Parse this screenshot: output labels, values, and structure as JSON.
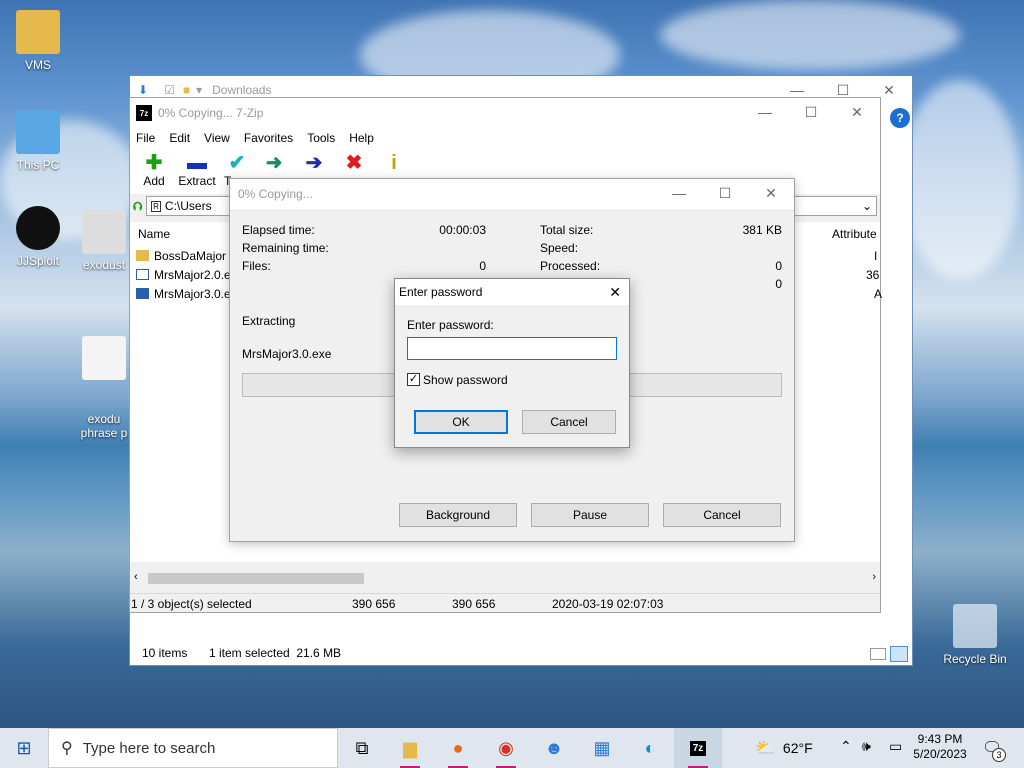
{
  "desktop": {
    "icons": [
      {
        "label": "VMS"
      },
      {
        "label": "This PC"
      },
      {
        "label": "JJSploit"
      },
      {
        "label": "exodust"
      },
      {
        "label": "exodu\nphrase p"
      },
      {
        "label": "Recycle Bin"
      }
    ]
  },
  "explorer": {
    "title": "Downloads",
    "status_items": "10 items",
    "status_selected": "1 item selected  21.6 MB"
  },
  "zip": {
    "title": "0% Copying... 7-Zip",
    "menu": [
      "File",
      "Edit",
      "View",
      "Favorites",
      "Tools",
      "Help"
    ],
    "toolbar": [
      "Add",
      "Extract",
      "T"
    ],
    "address": "C:\\Users",
    "columns": {
      "name": "Name",
      "attributes": "Attribute"
    },
    "files": [
      "BossDaMajor",
      "MrsMajor2.0.ex",
      "MrsMajor3.0.ex"
    ],
    "right_col_partial": [
      "I",
      "36",
      "A"
    ],
    "status": {
      "selected": "1 / 3 object(s) selected",
      "size": "390 656",
      "packed": "390 656",
      "modified": "2020-03-19 02:07:03"
    }
  },
  "progress": {
    "title": "0% Copying...",
    "elapsed_label": "Elapsed time:",
    "elapsed_value": "00:00:03",
    "remaining_label": "Remaining time:",
    "files_label": "Files:",
    "files_value": "0",
    "total_label": "Total size:",
    "total_value": "381 KB",
    "speed_label": "Speed:",
    "processed_label": "Processed:",
    "processed_value": "0",
    "fourth_value": "0",
    "operation": "Extracting",
    "current_file": "MrsMajor3.0.exe",
    "progress_fraction": 0.0,
    "buttons": {
      "background": "Background",
      "pause": "Pause",
      "cancel": "Cancel"
    }
  },
  "password_dialog": {
    "title": "Enter password",
    "prompt": "Enter password:",
    "value": "",
    "show_password_label": "Show password",
    "show_password_checked": true,
    "ok": "OK",
    "cancel": "Cancel"
  },
  "taskbar": {
    "search_placeholder": "Type here to search",
    "weather": "62°F",
    "time": "9:43 PM",
    "date": "5/20/2023",
    "notification_count": "3"
  }
}
